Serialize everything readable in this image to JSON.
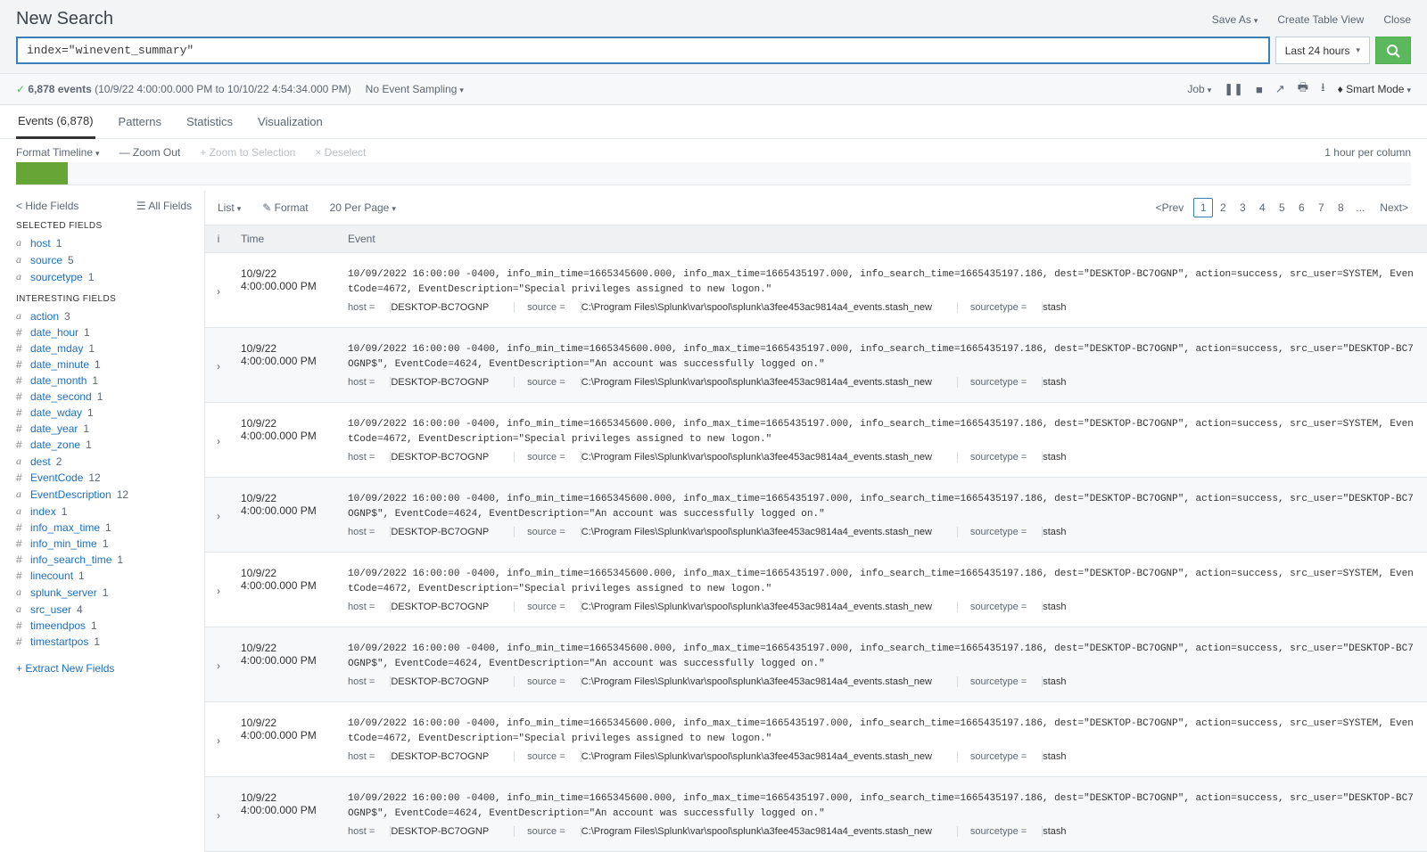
{
  "header": {
    "title": "New Search",
    "actions": {
      "save_as": "Save As",
      "create_table_view": "Create Table View",
      "close": "Close"
    }
  },
  "search": {
    "query": "index=\"winevent_summary\"",
    "time_label": "Last 24 hours"
  },
  "status": {
    "event_count_label": "6,878 events",
    "time_range": "(10/9/22 4:00:00.000 PM to 10/10/22 4:54:34.000 PM)",
    "sampling": "No Event Sampling",
    "job_label": "Job",
    "mode_label": "Smart Mode"
  },
  "tabs": {
    "events": "Events (6,878)",
    "patterns": "Patterns",
    "statistics": "Statistics",
    "visualization": "Visualization"
  },
  "timeline": {
    "format": "Format Timeline",
    "zoom_out": "— Zoom Out",
    "zoom_sel": "+ Zoom to Selection",
    "deselect": "× Deselect",
    "per_column": "1 hour per column"
  },
  "results_toolbar": {
    "view": "List",
    "format": "Format",
    "per_page": "20 Per Page",
    "prev": "Prev",
    "next": "Next",
    "pages": [
      "1",
      "2",
      "3",
      "4",
      "5",
      "6",
      "7",
      "8",
      "..."
    ]
  },
  "sidebar": {
    "hide": "Hide Fields",
    "all": "All Fields",
    "selected_heading": "SELECTED FIELDS",
    "interesting_heading": "INTERESTING FIELDS",
    "selected": [
      {
        "t": "a",
        "n": "host",
        "c": "1"
      },
      {
        "t": "a",
        "n": "source",
        "c": "5"
      },
      {
        "t": "a",
        "n": "sourcetype",
        "c": "1"
      }
    ],
    "interesting": [
      {
        "t": "a",
        "n": "action",
        "c": "3"
      },
      {
        "t": "#",
        "n": "date_hour",
        "c": "1"
      },
      {
        "t": "#",
        "n": "date_mday",
        "c": "1"
      },
      {
        "t": "#",
        "n": "date_minute",
        "c": "1"
      },
      {
        "t": "#",
        "n": "date_month",
        "c": "1"
      },
      {
        "t": "#",
        "n": "date_second",
        "c": "1"
      },
      {
        "t": "#",
        "n": "date_wday",
        "c": "1"
      },
      {
        "t": "#",
        "n": "date_year",
        "c": "1"
      },
      {
        "t": "#",
        "n": "date_zone",
        "c": "1"
      },
      {
        "t": "a",
        "n": "dest",
        "c": "2"
      },
      {
        "t": "#",
        "n": "EventCode",
        "c": "12"
      },
      {
        "t": "a",
        "n": "EventDescription",
        "c": "12"
      },
      {
        "t": "a",
        "n": "index",
        "c": "1"
      },
      {
        "t": "#",
        "n": "info_max_time",
        "c": "1"
      },
      {
        "t": "#",
        "n": "info_min_time",
        "c": "1"
      },
      {
        "t": "#",
        "n": "info_search_time",
        "c": "1"
      },
      {
        "t": "#",
        "n": "linecount",
        "c": "1"
      },
      {
        "t": "a",
        "n": "splunk_server",
        "c": "1"
      },
      {
        "t": "a",
        "n": "src_user",
        "c": "4"
      },
      {
        "t": "#",
        "n": "timeendpos",
        "c": "1"
      },
      {
        "t": "#",
        "n": "timestartpos",
        "c": "1"
      }
    ],
    "extract": "+ Extract New Fields"
  },
  "table": {
    "col_time": "Time",
    "col_event": "Event",
    "meta": {
      "host_k": "host =",
      "host_v": "DESKTOP-BC7OGNP",
      "source_k": "source =",
      "source_v": "C:\\Program Files\\Splunk\\var\\spool\\splunk\\a3fee453ac9814a4_events.stash_new",
      "st_k": "sourcetype =",
      "st_v": "stash"
    }
  },
  "events": [
    {
      "date": "10/9/22",
      "time": "4:00:00.000 PM",
      "raw": "10/09/2022 16:00:00 -0400, info_min_time=1665345600.000, info_max_time=1665435197.000, info_search_time=1665435197.186, dest=\"DESKTOP-BC7OGNP\", action=success, src_user=SYSTEM, EventCode=4672, EventDescription=\"Special privileges assigned to new logon.\""
    },
    {
      "date": "10/9/22",
      "time": "4:00:00.000 PM",
      "raw": "10/09/2022 16:00:00 -0400, info_min_time=1665345600.000, info_max_time=1665435197.000, info_search_time=1665435197.186, dest=\"DESKTOP-BC7OGNP\", action=success, src_user=\"DESKTOP-BC7OGNP$\", EventCode=4624, EventDescription=\"An account was successfully logged on.\""
    },
    {
      "date": "10/9/22",
      "time": "4:00:00.000 PM",
      "raw": "10/09/2022 16:00:00 -0400, info_min_time=1665345600.000, info_max_time=1665435197.000, info_search_time=1665435197.186, dest=\"DESKTOP-BC7OGNP\", action=success, src_user=SYSTEM, EventCode=4672, EventDescription=\"Special privileges assigned to new logon.\""
    },
    {
      "date": "10/9/22",
      "time": "4:00:00.000 PM",
      "raw": "10/09/2022 16:00:00 -0400, info_min_time=1665345600.000, info_max_time=1665435197.000, info_search_time=1665435197.186, dest=\"DESKTOP-BC7OGNP\", action=success, src_user=\"DESKTOP-BC7OGNP$\", EventCode=4624, EventDescription=\"An account was successfully logged on.\""
    },
    {
      "date": "10/9/22",
      "time": "4:00:00.000 PM",
      "raw": "10/09/2022 16:00:00 -0400, info_min_time=1665345600.000, info_max_time=1665435197.000, info_search_time=1665435197.186, dest=\"DESKTOP-BC7OGNP\", action=success, src_user=SYSTEM, EventCode=4672, EventDescription=\"Special privileges assigned to new logon.\""
    },
    {
      "date": "10/9/22",
      "time": "4:00:00.000 PM",
      "raw": "10/09/2022 16:00:00 -0400, info_min_time=1665345600.000, info_max_time=1665435197.000, info_search_time=1665435197.186, dest=\"DESKTOP-BC7OGNP\", action=success, src_user=\"DESKTOP-BC7OGNP$\", EventCode=4624, EventDescription=\"An account was successfully logged on.\""
    },
    {
      "date": "10/9/22",
      "time": "4:00:00.000 PM",
      "raw": "10/09/2022 16:00:00 -0400, info_min_time=1665345600.000, info_max_time=1665435197.000, info_search_time=1665435197.186, dest=\"DESKTOP-BC7OGNP\", action=success, src_user=SYSTEM, EventCode=4672, EventDescription=\"Special privileges assigned to new logon.\""
    },
    {
      "date": "10/9/22",
      "time": "4:00:00.000 PM",
      "raw": "10/09/2022 16:00:00 -0400, info_min_time=1665345600.000, info_max_time=1665435197.000, info_search_time=1665435197.186, dest=\"DESKTOP-BC7OGNP\", action=success, src_user=\"DESKTOP-BC7OGNP$\", EventCode=4624, EventDescription=\"An account was successfully logged on.\""
    }
  ]
}
